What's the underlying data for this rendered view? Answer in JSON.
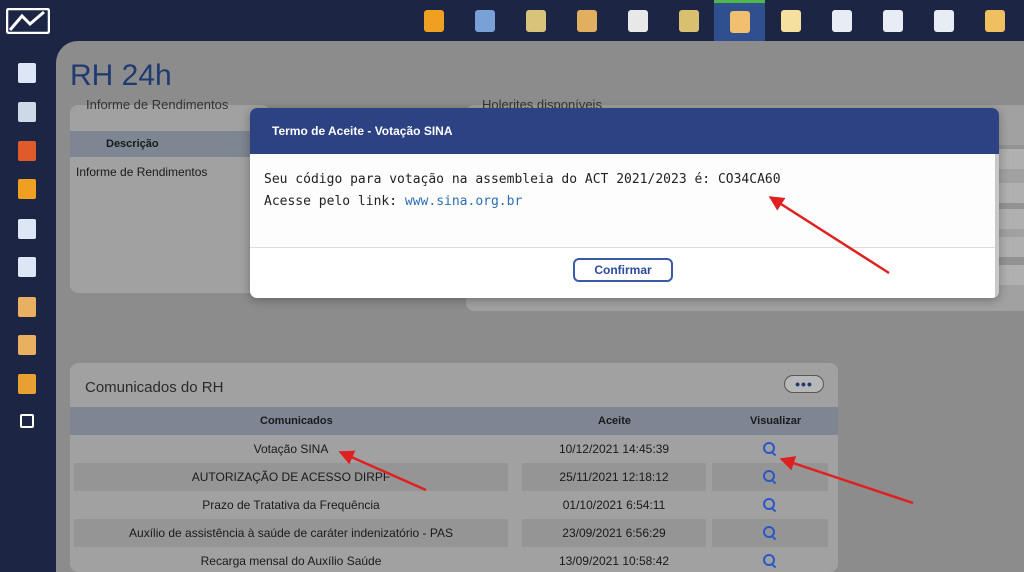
{
  "page_title": "RH 24h",
  "top_icons": [
    {
      "name": "people-group-icon",
      "color": "#f0a020"
    },
    {
      "name": "id-card-icon",
      "color": "#7aa0d8"
    },
    {
      "name": "user-bell-icon",
      "color": "#d9c27a"
    },
    {
      "name": "graduate-icon",
      "color": "#e0b060"
    },
    {
      "name": "document-user-icon",
      "color": "#e8e8e8"
    },
    {
      "name": "calendar-icon",
      "color": "#d9c070"
    },
    {
      "name": "person-icon",
      "color": "#f0c070"
    },
    {
      "name": "chart-document-icon",
      "color": "#f5e0a0"
    },
    {
      "name": "document-edit-icon",
      "color": "#e8ecf5"
    },
    {
      "name": "document-edit-icon",
      "color": "#e8ecf5"
    },
    {
      "name": "document-edit-icon",
      "color": "#e8ecf5"
    },
    {
      "name": "wand-icon",
      "color": "#f0c060"
    }
  ],
  "sidebar_icons": [
    {
      "name": "document-icon",
      "color": "#dde6f5"
    },
    {
      "name": "disc-icon",
      "color": "#cfd8e8"
    },
    {
      "name": "calendar-icon",
      "color": "#e05a2a"
    },
    {
      "name": "people-icon",
      "color": "#f0a020"
    },
    {
      "name": "document-icon",
      "color": "#dde6f5"
    },
    {
      "name": "document-icon",
      "color": "#dde6f5"
    },
    {
      "name": "document-user-icon",
      "color": "#e8b060"
    },
    {
      "name": "document-user-icon",
      "color": "#e8b060"
    },
    {
      "name": "card-icon",
      "color": "#e8a030"
    },
    {
      "name": "logout-icon",
      "color": "#ffffff"
    }
  ],
  "info_card": {
    "clipped_title": "Informe de Rendimentos",
    "col_descricao": "Descrição",
    "row_text": "Informe de Rendimentos"
  },
  "right_card": {
    "clipped_title": "Holerites disponíveis"
  },
  "comunicados": {
    "title": "Comunicados do RH",
    "more": "•••",
    "headers": {
      "comunicados": "Comunicados",
      "aceite": "Aceite",
      "visualizar": "Visualizar"
    },
    "rows": [
      {
        "desc": "Votação SINA",
        "date": "10/12/2021 14:45:39"
      },
      {
        "desc": "AUTORIZAÇÃO DE ACESSO DIRPF",
        "date": "25/11/2021 12:18:12"
      },
      {
        "desc": "Prazo de Tratativa da Frequência",
        "date": "01/10/2021 6:54:11"
      },
      {
        "desc": "Auxílio de assistência à saúde de caráter indenizatório - PAS",
        "date": "23/09/2021 6:56:29"
      },
      {
        "desc": "Recarga mensal do Auxílio Saúde",
        "date": "13/09/2021 10:58:42"
      }
    ]
  },
  "modal": {
    "title": "Termo de Aceite - Votação SINA",
    "line1": "Seu código para votação na assembleia do ACT 2021/2023 é: CO34CA60",
    "line2_prefix": "Acesse pelo link: ",
    "link": "www.sina.org.br",
    "confirm": "Confirmar"
  },
  "colors": {
    "nav_bg": "#1c2544",
    "modal_header": "#2c4283",
    "title_blue": "#1f3a70",
    "arrow": "#e02020",
    "link": "#2b6fb8"
  }
}
